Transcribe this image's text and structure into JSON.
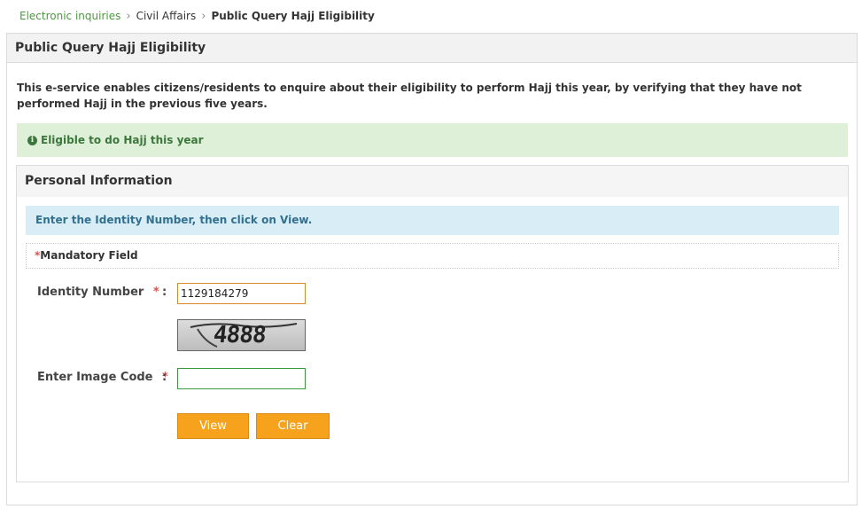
{
  "breadcrumb": {
    "items": [
      {
        "label": "Electronic inquiries"
      },
      {
        "label": "Civil Affairs"
      },
      {
        "label": "Public Query Hajj Eligibility"
      }
    ]
  },
  "page": {
    "title": "Public Query Hajj Eligibility",
    "description": "This e-service enables citizens/residents to enquire about their eligibility to perform Hajj this year, by verifying that they have not performed Hajj in the previous five years."
  },
  "result_alert": {
    "icon": "info-circle-icon",
    "text": "Eligible to do Hajj this year",
    "color": "#3c763d",
    "background": "#dff0d8"
  },
  "personal_info": {
    "title": "Personal Information",
    "instruction": "Enter the Identity Number, then click on View.",
    "mandatory_marker": "*",
    "mandatory_note": "Mandatory Field",
    "identity": {
      "label": "Identity Number",
      "value": "1129184279"
    },
    "captcha": {
      "text": "4888"
    },
    "image_code": {
      "label": "Enter Image Code",
      "value": ""
    },
    "colon": ":",
    "buttons": {
      "view": "View",
      "clear": "Clear"
    }
  },
  "colors": {
    "accent_button": "#f7a21c",
    "breadcrumb_link": "#4b9a3d",
    "required": "#d9534f"
  }
}
